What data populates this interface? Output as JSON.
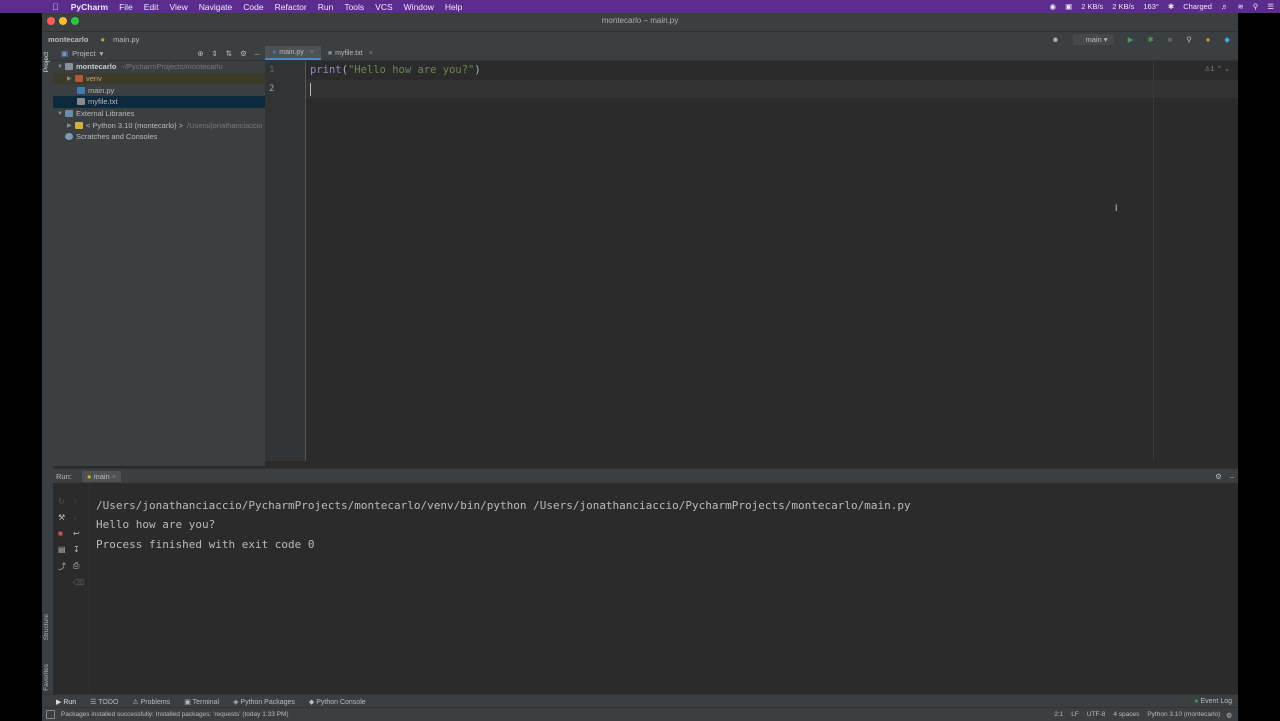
{
  "menubar": {
    "app_name": "PyCharm",
    "items": [
      "File",
      "Edit",
      "View",
      "Navigate",
      "Code",
      "Refactor",
      "Run",
      "Tools",
      "VCS",
      "Window",
      "Help"
    ],
    "status": {
      "temperature": "163°",
      "battery": "Charged",
      "net_up": "2 KB/s",
      "net_down": "2 KB/s"
    }
  },
  "window": {
    "title": "montecarlo – main.py"
  },
  "navbar": {
    "project": "montecarlo",
    "file": "main.py"
  },
  "toolbar": {
    "run_config": "main"
  },
  "project_panel": {
    "title": "Project",
    "tree": [
      {
        "label": "montecarlo",
        "path": "~/PycharmProjects/montecarlo",
        "indent": 0,
        "icon": "folder-icon"
      },
      {
        "label": "venv",
        "indent": 1,
        "icon": "folder-icon"
      },
      {
        "label": "main.py",
        "indent": 2,
        "icon": "python-file-icon"
      },
      {
        "label": "myfile.txt",
        "indent": 2,
        "icon": "text-file-icon"
      },
      {
        "label": "External Libraries",
        "indent": 0,
        "icon": "library-icon"
      },
      {
        "label": "< Python 3.10 (montecarlo) >",
        "path": "/Users/jonathanciaccio",
        "indent": 1,
        "icon": "python-sdk-icon"
      },
      {
        "label": "Scratches and Consoles",
        "indent": 0,
        "icon": "scratches-icon"
      }
    ]
  },
  "editor": {
    "tabs": [
      {
        "label": "main.py",
        "active": true
      },
      {
        "label": "myfile.txt",
        "active": false
      }
    ],
    "lines": [
      {
        "number": "1",
        "func": "print",
        "open": "(",
        "string": "\"Hello how are you?\"",
        "close": ")"
      },
      {
        "number": "2"
      }
    ],
    "inspection": "1"
  },
  "run_panel": {
    "label": "Run:",
    "tab": "main",
    "output": [
      "/Users/jonathanciaccio/PycharmProjects/montecarlo/venv/bin/python /Users/jonathanciaccio/PycharmProjects/montecarlo/main.py",
      "Hello how are you?",
      "",
      "Process finished with exit code 0"
    ]
  },
  "side_labels": {
    "project": "Project",
    "structure": "Structure",
    "favorites": "Favorites"
  },
  "bottom_tools": [
    "Run",
    "TODO",
    "Problems",
    "Terminal",
    "Python Packages",
    "Python Console"
  ],
  "event_log": "Event Log",
  "status_bar": {
    "message": "Packages installed successfully: Installed packages: 'requests' (today 1:33 PM)",
    "position": "2:1",
    "line_sep": "LF",
    "encoding": "UTF-8",
    "indent": "4 spaces",
    "interpreter": "Python 3.10 (montecarlo)"
  },
  "colors": {
    "menubar": "#5b2c8c",
    "accent": "#4a88c7",
    "string": "#6a8759",
    "func": "#8888c6"
  }
}
